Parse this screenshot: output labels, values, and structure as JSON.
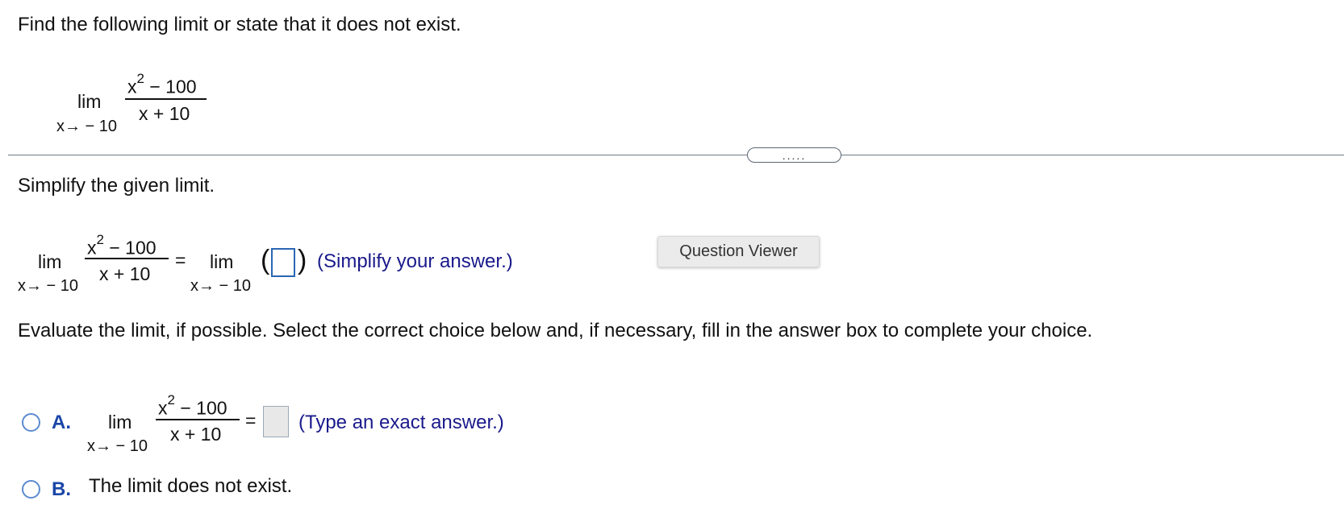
{
  "question": {
    "prompt": "Find the following limit or state that it does not exist.",
    "limit": {
      "lim": "lim",
      "numerator_base": "x",
      "numerator_exp": "2",
      "numerator_rest": "− 100",
      "denominator": "x + 10",
      "approach": "x→ − 10"
    }
  },
  "divider": {
    "expander_label": "....."
  },
  "step1": {
    "instruction": "Simplify the given limit.",
    "equals": "=",
    "rhs_lim": "lim",
    "rhs_approach": "x→ − 10",
    "open_paren": "(",
    "close_paren": ")",
    "hint": "(Simplify your answer.)"
  },
  "question_viewer_button": "Question Viewer",
  "step2": {
    "instruction": "Evaluate the limit, if possible. Select the correct choice below and, if necessary, fill in the answer box to complete your choice.",
    "choices": [
      {
        "letter": "A.",
        "equals": "=",
        "hint": "(Type an exact answer.)"
      },
      {
        "letter": "B.",
        "text": "The limit does not exist."
      }
    ]
  }
}
